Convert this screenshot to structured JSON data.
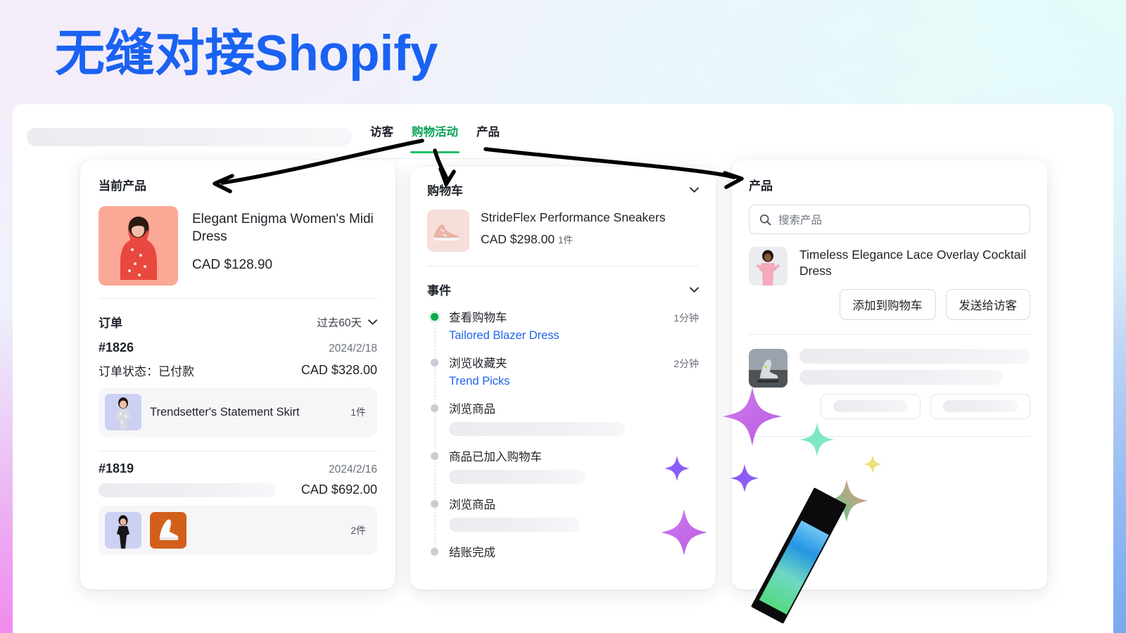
{
  "headline": "无缝对接Shopify",
  "colors": {
    "headline_blue": "#1a62f2",
    "tab_active_green": "#0aa35a",
    "link_blue": "#1f63e8",
    "event_current_green": "#0caa4f"
  },
  "tabs": [
    {
      "label": "访客",
      "active": false
    },
    {
      "label": "购物活动",
      "active": true
    },
    {
      "label": "产品",
      "active": false
    }
  ],
  "left_card": {
    "title": "当前产品",
    "current_product": {
      "name": "Elegant Enigma Women's Midi Dress",
      "price": "CAD $128.90",
      "image_alt": "woman-in-red-floral-midi-dress"
    },
    "orders_title": "订单",
    "orders_filter": "过去60天",
    "orders": [
      {
        "id": "#1826",
        "date": "2024/2/18",
        "status_label": "订单状态：已付款",
        "total": "CAD $328.00",
        "item_name": "Trendsetter's Statement Skirt",
        "qty": "1件",
        "thumbs": [
          "silver-sequin-skirt-model"
        ]
      },
      {
        "id": "#1819",
        "date": "2024/2/16",
        "status_label": "",
        "total": "CAD $692.00",
        "item_name": "",
        "qty": "2件",
        "thumbs": [
          "black-dress-model",
          "white-sneaker-orange-bg"
        ]
      }
    ]
  },
  "mid_card": {
    "cart_title": "购物车",
    "cart_item": {
      "name": "StrideFlex Performance Sneakers",
      "price": "CAD $298.00",
      "qty": "1件",
      "image_alt": "pink-running-sneaker"
    },
    "events_title": "事件",
    "events": [
      {
        "title": "查看购物车",
        "link": "Tailored Blazer Dress",
        "time": "1分钟",
        "current": true,
        "skeleton": false
      },
      {
        "title": "浏览收藏夹",
        "link": "Trend Picks",
        "time": "2分钟",
        "current": false,
        "skeleton": false
      },
      {
        "title": "浏览商品",
        "link": "",
        "time": "",
        "current": false,
        "skeleton": true
      },
      {
        "title": "商品已加入购物车",
        "link": "",
        "time": "",
        "current": false,
        "skeleton": true
      },
      {
        "title": "浏览商品",
        "link": "",
        "time": "",
        "current": false,
        "skeleton": true
      },
      {
        "title": "结账完成",
        "link": "",
        "time": "",
        "current": false,
        "skeleton": false
      }
    ]
  },
  "right_card": {
    "title": "产品",
    "search_placeholder": "搜索产品",
    "search_icon": "search-icon",
    "product": {
      "name": "Timeless Elegance Lace Overlay Cocktail Dress",
      "image_alt": "woman-in-pink-lace-cocktail-dress"
    },
    "buttons": {
      "add_to_cart": "添加到购物车",
      "send_to_visitor": "发送给访客"
    },
    "placeholder_product": {
      "image_alt": "grey-sneakers-on-street"
    }
  },
  "decorations": {
    "wand_colors": [
      "#1f95e8",
      "#5ad28a"
    ],
    "sparkle_colors": [
      "#c066e8",
      "#7ee8c0",
      "#8b5cf6",
      "#eee07a",
      "#61d98a",
      "#d96fd9"
    ]
  }
}
